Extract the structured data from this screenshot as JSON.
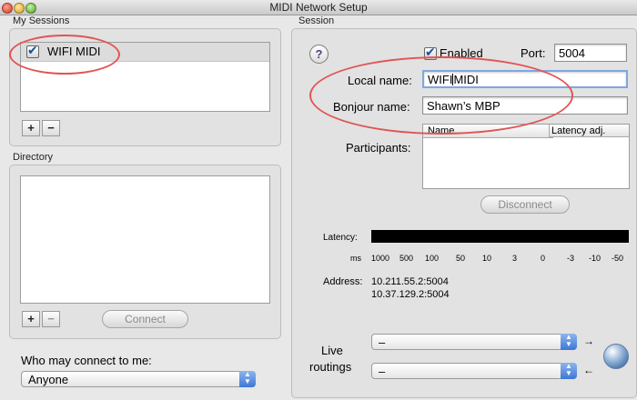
{
  "window": {
    "title": "MIDI Network Setup"
  },
  "my_sessions": {
    "heading": "My Sessions",
    "items": [
      {
        "label": "WIFI MIDI",
        "checked": true
      }
    ],
    "add_label": "+",
    "remove_label": "−"
  },
  "directory": {
    "heading": "Directory",
    "add_label": "+",
    "remove_label": "−",
    "connect_label": "Connect"
  },
  "who_may_connect": {
    "label": "Who may connect to me:",
    "value": "Anyone"
  },
  "session": {
    "heading": "Session",
    "help_label": "?",
    "enabled_label": "Enabled",
    "enabled": true,
    "port_label": "Port:",
    "port_value": "5004",
    "local_name_label": "Local name:",
    "local_name_value": "WIFIMIDI",
    "local_name_before_caret": "WIFI",
    "local_name_after_caret": "MIDI",
    "bonjour_name_label": "Bonjour name:",
    "bonjour_name_value": "Shawn’s MBP",
    "participants_label": "Participants:",
    "participants_columns": [
      "Name",
      "Latency adj."
    ],
    "disconnect_label": "Disconnect",
    "latency_label": "Latency:",
    "ms_label": "ms",
    "latency_ticks": [
      "1000",
      "500",
      "100",
      "50",
      "10",
      "3",
      "0",
      "-3",
      "-10",
      "-50"
    ],
    "address_label": "Address:",
    "addresses": [
      "10.211.55.2:5004",
      "10.37.129.2:5004"
    ],
    "live_routings_label_1": "Live",
    "live_routings_label_2": "routings",
    "routing_1_value": "–",
    "routing_2_value": "–",
    "routing_1_arrow": "→",
    "routing_2_arrow": "←"
  },
  "colors": {
    "annotation": "#e05555",
    "focus_ring": "#7fa7df",
    "selection": "#dcdcdc"
  }
}
